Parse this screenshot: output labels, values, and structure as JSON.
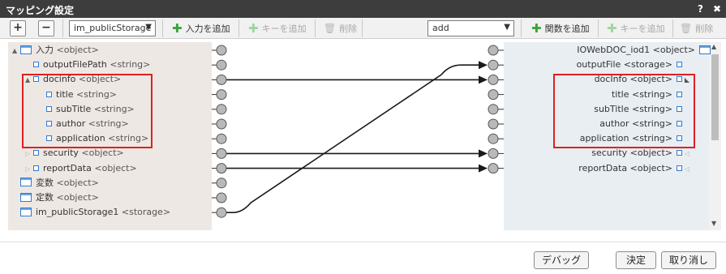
{
  "window": {
    "title": "マッピング設定",
    "help_label": "?",
    "close_label": "✖"
  },
  "toolbar": {
    "expand_label": "+",
    "collapse_label": "−",
    "left_select_value": "im_publicStorage",
    "add_input_label": "入力を追加",
    "add_key_label": "キーを追加",
    "delete_label": "削除",
    "right_select_value": "add",
    "add_function_label": "関数を追加",
    "add_key2_label": "キーを追加",
    "delete2_label": "削除"
  },
  "left_tree": [
    {
      "name": "入力",
      "type": "<object>",
      "level": 0,
      "twisty": "▲",
      "icon": "window"
    },
    {
      "name": "outputFilePath",
      "type": "<string>",
      "level": 1,
      "twisty": "",
      "icon": "object"
    },
    {
      "name": "docinfo",
      "type": "<object>",
      "level": 1,
      "twisty": "▲",
      "icon": "object"
    },
    {
      "name": "title",
      "type": "<string>",
      "level": 2,
      "twisty": "",
      "icon": "object"
    },
    {
      "name": "subTitle",
      "type": "<string>",
      "level": 2,
      "twisty": "",
      "icon": "object"
    },
    {
      "name": "author",
      "type": "<string>",
      "level": 2,
      "twisty": "",
      "icon": "object"
    },
    {
      "name": "application",
      "type": "<string>",
      "level": 2,
      "twisty": "",
      "icon": "object"
    },
    {
      "name": "security",
      "type": "<object>",
      "level": 1,
      "twisty": "▷",
      "icon": "object"
    },
    {
      "name": "reportData",
      "type": "<object>",
      "level": 1,
      "twisty": "▷",
      "icon": "object"
    },
    {
      "name": "変数",
      "type": "<object>",
      "level": 0,
      "twisty": "",
      "icon": "window"
    },
    {
      "name": "定数",
      "type": "<object>",
      "level": 0,
      "twisty": "",
      "icon": "window"
    },
    {
      "name": "im_publicStorage1",
      "type": "<storage>",
      "level": 0,
      "twisty": "",
      "icon": "window"
    }
  ],
  "right_tree": [
    {
      "name": "IOWebDOC_iod1",
      "type": "<object>",
      "level": 0,
      "twisty": "◣",
      "icon": "window"
    },
    {
      "name": "outputFile",
      "type": "<storage>",
      "level": 1,
      "twisty": "",
      "icon": "object"
    },
    {
      "name": "docInfo",
      "type": "<object>",
      "level": 1,
      "twisty": "◣",
      "icon": "object"
    },
    {
      "name": "title",
      "type": "<string>",
      "level": 2,
      "twisty": "",
      "icon": "object"
    },
    {
      "name": "subTitle",
      "type": "<string>",
      "level": 2,
      "twisty": "",
      "icon": "object"
    },
    {
      "name": "author",
      "type": "<string>",
      "level": 2,
      "twisty": "",
      "icon": "object"
    },
    {
      "name": "application",
      "type": "<string>",
      "level": 2,
      "twisty": "",
      "icon": "object"
    },
    {
      "name": "security",
      "type": "<object>",
      "level": 1,
      "twisty": "◁",
      "icon": "object"
    },
    {
      "name": "reportData",
      "type": "<object>",
      "level": 1,
      "twisty": "◁",
      "icon": "object"
    }
  ],
  "mappings": [
    {
      "from": 2,
      "to": 2
    },
    {
      "from": 7,
      "to": 7
    },
    {
      "from": 8,
      "to": 8
    },
    {
      "from": 11,
      "to": 1
    }
  ],
  "footer": {
    "debug_label": "デバッグ",
    "ok_label": "決定",
    "cancel_label": "取り消し"
  },
  "colors": {
    "titlebar": "#3d3d3d",
    "left_panel": "#eee8e4",
    "right_panel": "#e9eef2",
    "highlight": "#e02020",
    "node_fill": "#b9b9b9",
    "line": "#1a1a1a",
    "add_icon": "#3aa53a",
    "tree_icon": "#2f7bd0"
  }
}
